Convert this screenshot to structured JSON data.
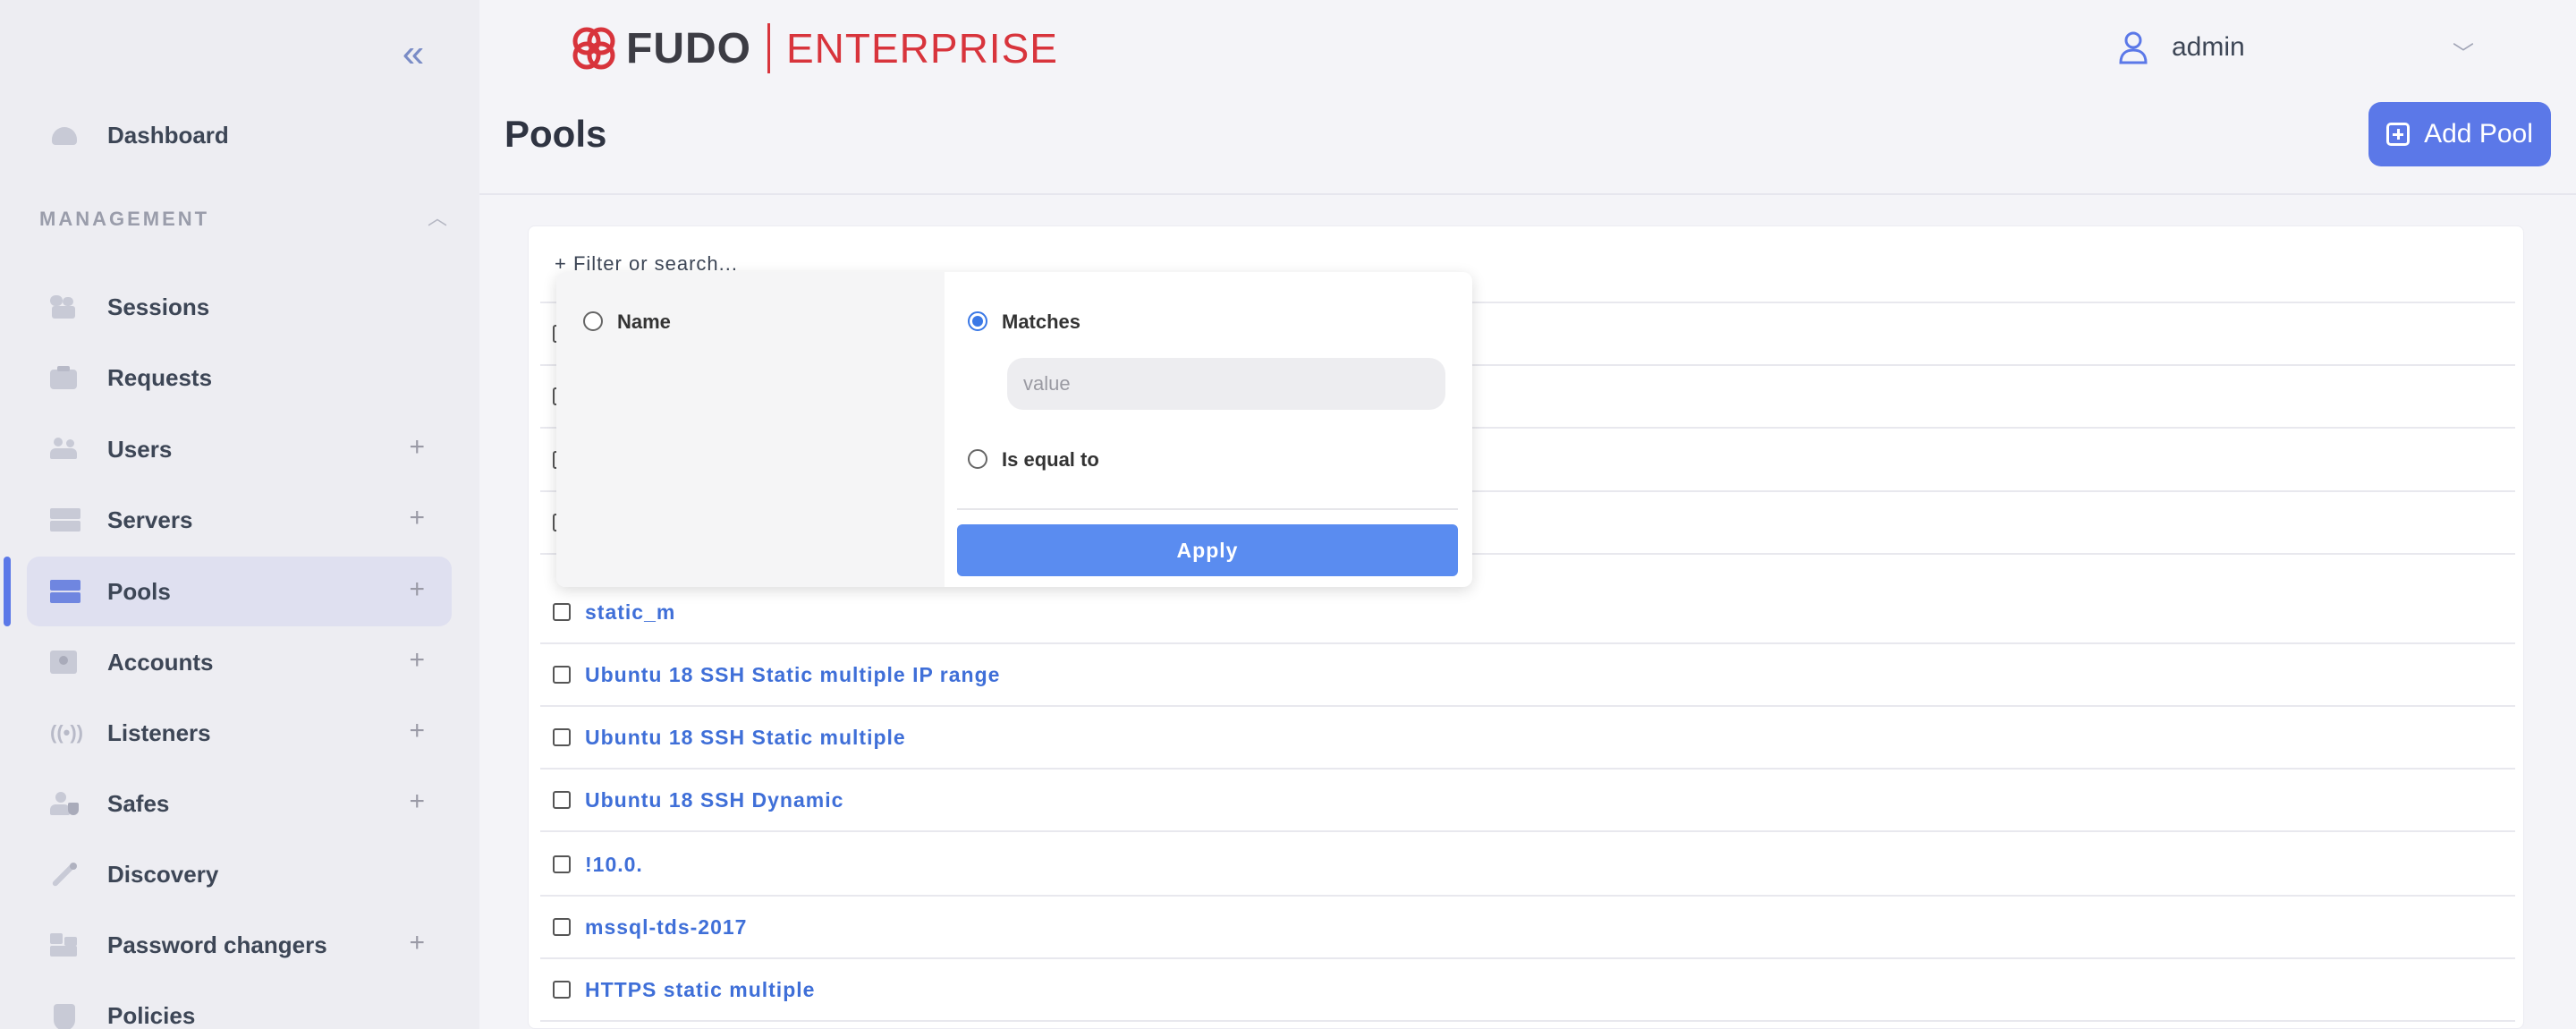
{
  "brand": {
    "name": "FUDO",
    "edition": "ENTERPRISE",
    "accent": "#d8343c"
  },
  "user": {
    "name": "admin"
  },
  "page": {
    "title": "Pools",
    "add_button": "Add Pool"
  },
  "sidebar": {
    "dashboard": "Dashboard",
    "section": "MANAGEMENT",
    "items": [
      {
        "label": "Sessions",
        "icon": "sessions-icon",
        "plus": false
      },
      {
        "label": "Requests",
        "icon": "requests-icon",
        "plus": false
      },
      {
        "label": "Users",
        "icon": "users-icon",
        "plus": true
      },
      {
        "label": "Servers",
        "icon": "servers-icon",
        "plus": true
      },
      {
        "label": "Pools",
        "icon": "pools-icon",
        "plus": true,
        "active": true
      },
      {
        "label": "Accounts",
        "icon": "accounts-icon",
        "plus": true
      },
      {
        "label": "Listeners",
        "icon": "listeners-icon",
        "plus": true
      },
      {
        "label": "Safes",
        "icon": "safes-icon",
        "plus": true
      },
      {
        "label": "Discovery",
        "icon": "discovery-icon",
        "plus": false
      },
      {
        "label": "Password changers",
        "icon": "password-changers-icon",
        "plus": true
      },
      {
        "label": "Policies",
        "icon": "policies-icon",
        "plus": false
      }
    ],
    "plus_symbol": "+"
  },
  "filter": {
    "search_text": "+ Filter or search...",
    "field_name": "Name",
    "op_matches": "Matches",
    "op_equal": "Is equal to",
    "value_placeholder": "value",
    "apply": "Apply",
    "selected_op": "Matches"
  },
  "pools": [
    {
      "label": ""
    },
    {
      "label": ""
    },
    {
      "label": ""
    },
    {
      "label": ""
    },
    {
      "label": "static_m"
    },
    {
      "label": "Ubuntu 18 SSH Static multiple IP range"
    },
    {
      "label": "Ubuntu 18 SSH Static multiple"
    },
    {
      "label": "Ubuntu 18 SSH Dynamic"
    },
    {
      "label": "!10.0."
    },
    {
      "label": "mssql-tds-2017"
    },
    {
      "label": "HTTPS static multiple"
    }
  ],
  "colors": {
    "primary": "#5b78e8",
    "link": "#3f6fd8",
    "apply": "#5a8cf0"
  }
}
